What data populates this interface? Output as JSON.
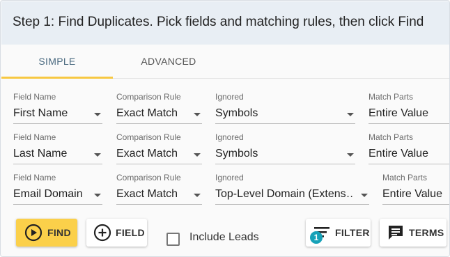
{
  "header": {
    "title": "Step 1: Find Duplicates. Pick fields and matching rules, then click Find"
  },
  "tabs": [
    {
      "label": "SIMPLE",
      "active": true
    },
    {
      "label": "ADVANCED",
      "active": false
    }
  ],
  "rows": [
    {
      "field_label": "Field Name",
      "field_value": "First Name",
      "rule_label": "Comparison Rule",
      "rule_value": "Exact Match",
      "ignored_label": "Ignored",
      "ignored_value": "Symbols",
      "parts_label": "Match Parts",
      "parts_value": "Entire Value"
    },
    {
      "field_label": "Field Name",
      "field_value": "Last Name",
      "rule_label": "Comparison Rule",
      "rule_value": "Exact Match",
      "ignored_label": "Ignored",
      "ignored_value": "Symbols",
      "parts_label": "Match Parts",
      "parts_value": "Entire Value"
    },
    {
      "field_label": "Field Name",
      "field_value": "Email Domain",
      "rule_label": "Comparison Rule",
      "rule_value": "Exact Match",
      "ignored_label": "Ignored",
      "ignored_value": "Top-Level Domain (Extens…",
      "parts_label": "Match Parts",
      "parts_value": "Entire Value"
    }
  ],
  "toolbar": {
    "find_label": "FIND",
    "field_label": "FIELD",
    "include_leads_label": "Include Leads",
    "include_leads_checked": false,
    "filter_label": "FILTER",
    "filter_badge": "1",
    "terms_label": "TERMS"
  },
  "colors": {
    "accent": "#fbd04a",
    "header_bg": "#e8eef4",
    "badge": "#17a2b8",
    "active_tab_text": "#4a6a80"
  },
  "icons": {
    "find": "play-circle-icon",
    "field": "add-circle-icon",
    "filter": "filter-list-icon",
    "terms": "comment-icon"
  }
}
